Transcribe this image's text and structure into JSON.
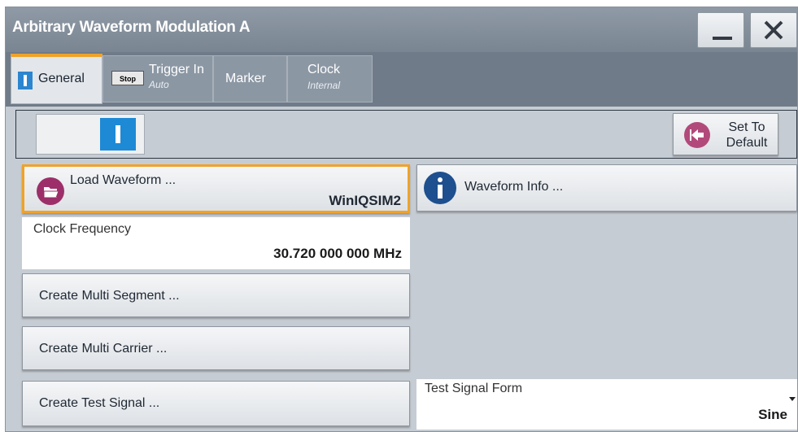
{
  "window": {
    "title": "Arbitrary Waveform Modulation A"
  },
  "tabs": [
    {
      "label": "General",
      "sublabel": ""
    },
    {
      "label": "Trigger In",
      "sublabel": "Auto",
      "badge": "Stop"
    },
    {
      "label": "Marker",
      "sublabel": ""
    },
    {
      "label": "Clock",
      "sublabel": "Internal"
    }
  ],
  "state_toggle": {
    "on": true
  },
  "set_default": {
    "label_line1": "Set To",
    "label_line2": "Default"
  },
  "load_waveform": {
    "label": "Load Waveform ...",
    "value": "WinIQSIM2"
  },
  "waveform_info": {
    "label": "Waveform Info ..."
  },
  "clock_frequency": {
    "label": "Clock Frequency",
    "value": "30.720 000 000 MHz"
  },
  "create_multi_segment": {
    "label": "Create Multi Segment ..."
  },
  "create_multi_carrier": {
    "label": "Create Multi Carrier ..."
  },
  "create_test_signal": {
    "label": "Create Test Signal ..."
  },
  "test_signal_form": {
    "label": "Test Signal Form",
    "value": "Sine"
  },
  "colors": {
    "accent": "#f0a229",
    "toggle_on": "#1e8ad6",
    "titlebar": "#7a8592"
  },
  "icons": {
    "minimize": "minimize-icon",
    "close": "close-icon",
    "set_default": "return-arrow-icon",
    "load": "folder-open-icon",
    "info": "info-icon"
  }
}
